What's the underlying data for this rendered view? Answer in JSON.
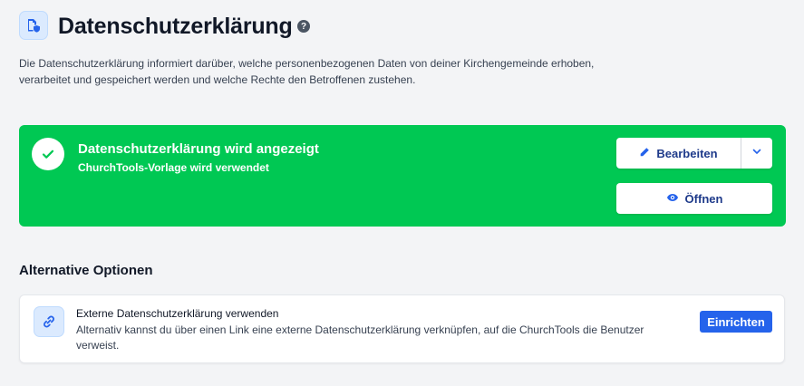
{
  "header": {
    "title": "Datenschutzerklärung",
    "help_symbol": "?",
    "intro": "Die Datenschutzerklärung informiert darüber, welche personenbezogenen Daten von deiner Kirchengemeinde erhoben, verarbeitet und gespeichert werden und welche Rechte den Betroffenen zustehen."
  },
  "status": {
    "title": "Datenschutzerklärung wird angezeigt",
    "subtitle": "ChurchTools-Vorlage wird verwendet",
    "edit_label": "Bearbeiten",
    "open_label": "Öffnen",
    "color": "#00c853"
  },
  "alternatives": {
    "section_title": "Alternative Optionen",
    "items": [
      {
        "title": "Externe Datenschutzerklärung verwenden",
        "description": "Alternativ kannst du über einen Link eine externe Datenschutzerklärung verknüpfen, auf die ChurchTools die Benutzer verweist.",
        "button_label": "Einrichten",
        "icon": "link-icon"
      }
    ]
  },
  "colors": {
    "accent": "#2563eb",
    "button_text": "#1e3a8a",
    "icon_bg": "#dbeafe"
  }
}
